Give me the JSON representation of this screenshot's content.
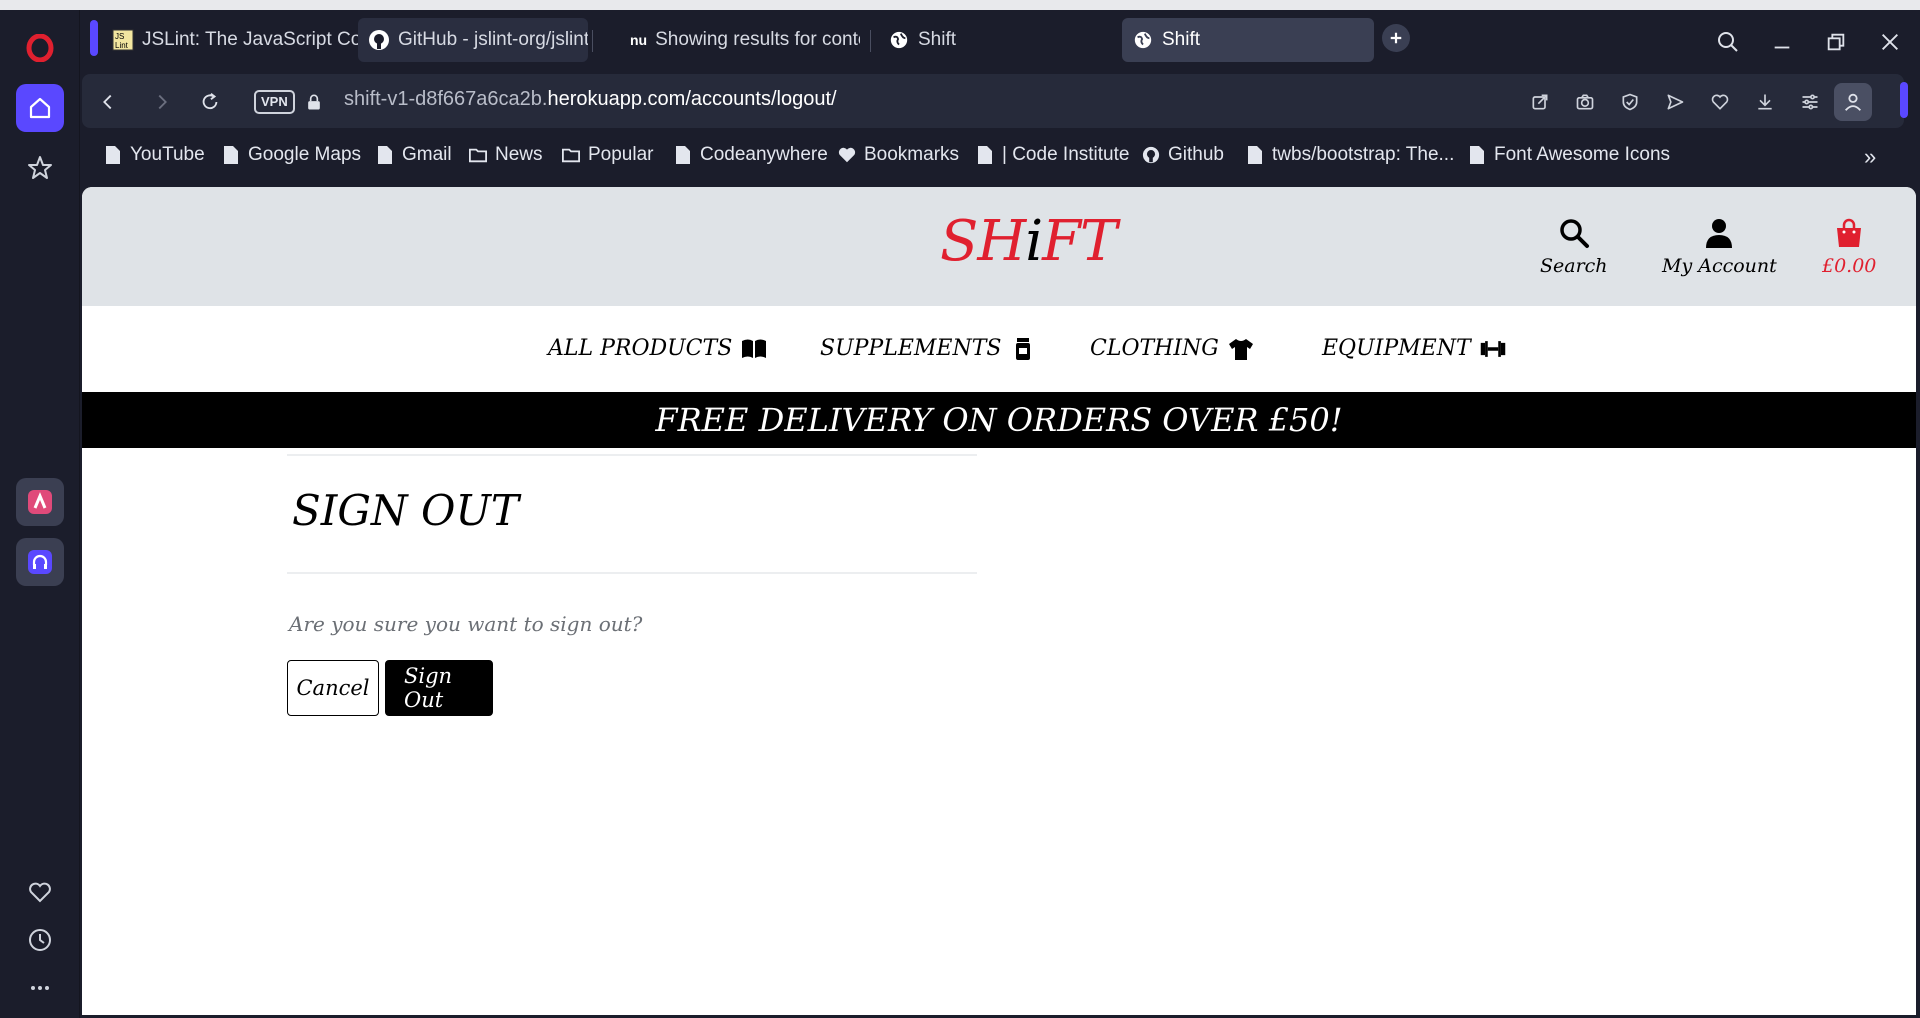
{
  "browser": {
    "tabs": [
      {
        "title": "JSLint: The JavaScript Code",
        "favicon": "jslint-icon"
      },
      {
        "title": "GitHub - jslint-org/jslint: JS",
        "favicon": "github-icon"
      },
      {
        "title": "Showing results for conten",
        "favicon": "nu-icon"
      },
      {
        "title": "Shift",
        "favicon": "globe-icon"
      },
      {
        "title": "Shift",
        "favicon": "globe-icon",
        "active": true
      }
    ],
    "vpn_label": "VPN",
    "url_prefix": "shift-v1-d8f667a6ca2b.",
    "url_host": "herokuapp.com",
    "url_path": "/accounts/logout/",
    "bookmarks": [
      {
        "label": "YouTube",
        "icon": "page-icon"
      },
      {
        "label": "Google Maps",
        "icon": "page-icon"
      },
      {
        "label": "Gmail",
        "icon": "page-icon"
      },
      {
        "label": "News",
        "icon": "folder-icon"
      },
      {
        "label": "Popular",
        "icon": "folder-icon"
      },
      {
        "label": "Codeanywhere",
        "icon": "page-icon"
      },
      {
        "label": "Bookmarks",
        "icon": "heart-icon"
      },
      {
        "label": "| Code Institute",
        "icon": "page-icon"
      },
      {
        "label": "Github",
        "icon": "github-icon"
      },
      {
        "label": "twbs/bootstrap: The...",
        "icon": "page-icon"
      },
      {
        "label": "Font Awesome Icons",
        "icon": "page-icon"
      }
    ],
    "more_bookmarks": "»"
  },
  "site": {
    "logo_pre": "SH",
    "logo_i": "i",
    "logo_post": "FT",
    "header": {
      "search_label": "Search",
      "account_label": "My Account",
      "bag_total": "£0.00"
    },
    "nav": [
      {
        "label": "ALL PRODUCTS",
        "icon": "book-icon"
      },
      {
        "label": "SUPPLEMENTS",
        "icon": "jar-icon"
      },
      {
        "label": "CLOTHING",
        "icon": "tshirt-icon"
      },
      {
        "label": "EQUIPMENT",
        "icon": "dumbbell-icon"
      }
    ],
    "banner": "FREE DELIVERY ON ORDERS OVER £50!",
    "signout": {
      "title": "SIGN OUT",
      "question": "Are you sure you want to sign out?",
      "cancel_label": "Cancel",
      "signout_label": "Sign Out"
    }
  },
  "colors": {
    "brand_red": "#e0202f",
    "header_bg": "#dfe3e7",
    "sidebar_accent": "#6b5cff"
  }
}
